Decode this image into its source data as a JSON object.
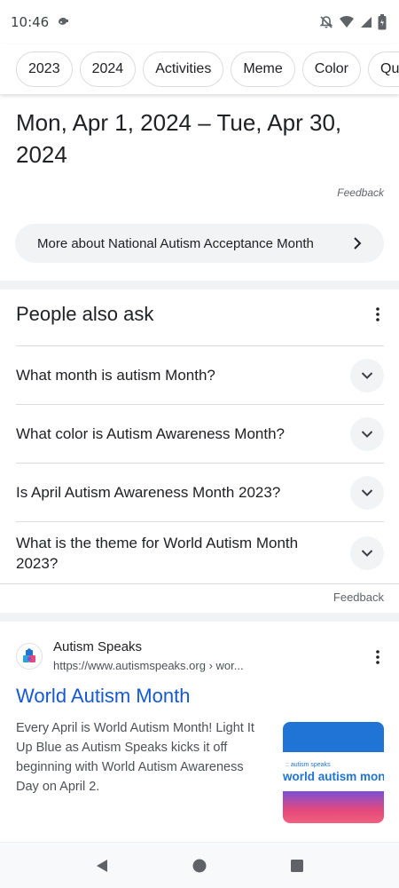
{
  "status_bar": {
    "time": "10:46"
  },
  "chips": [
    "2023",
    "2024",
    "Activities",
    "Meme",
    "Color",
    "Quot"
  ],
  "date_range": "Mon, Apr 1, 2024 – Tue, Apr 30, 2024",
  "feedback_top": "Feedback",
  "more_about": "More about National Autism Acceptance Month",
  "people_also_ask": {
    "title": "People also ask",
    "questions": [
      "What month is autism Month?",
      "What color is Autism Awareness Month?",
      "Is April Autism Awareness Month 2023?",
      "What is the theme for World Autism Month 2023?"
    ],
    "feedback": "Feedback"
  },
  "result": {
    "site_name": "Autism Speaks",
    "url": "https://www.autismspeaks.org › wor...",
    "title": "World Autism Month",
    "snippet": "Every April is World Autism Month! Light It Up Blue as Autism Speaks kicks it off beginning with World Autism Awareness Day on April 2.",
    "thumbnail": {
      "small_text": ":: autism speaks",
      "big_text": "world autism mon"
    }
  },
  "icons": {
    "status_left": [
      "assistant-icon"
    ],
    "status_right": [
      "bell-off-icon",
      "wifi-icon",
      "signal-icon",
      "battery-icon"
    ],
    "nav": [
      "back-icon",
      "home-icon",
      "recents-icon"
    ]
  },
  "colors": {
    "link": "#1558d6",
    "chip_border": "#dadce0",
    "muted_bg": "#f1f3f4"
  }
}
